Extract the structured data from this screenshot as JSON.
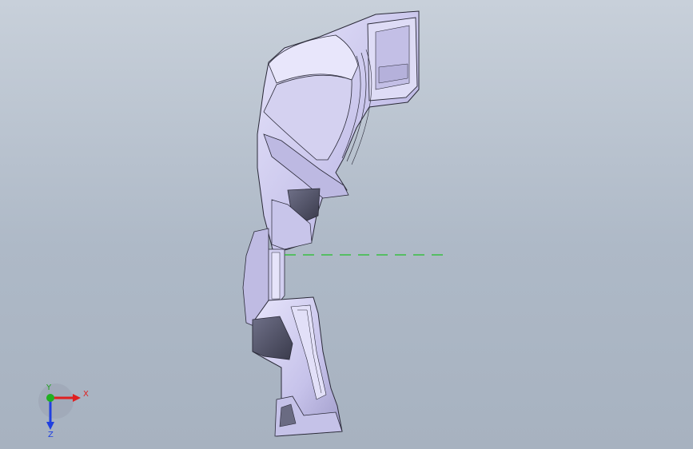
{
  "viewport": {
    "background_top": "#c8d0da",
    "background_bottom": "#a7b2c0"
  },
  "model": {
    "icon": "3d-part-side-view",
    "face_color": "#cbc8ec",
    "edge_color": "#2a2a38",
    "shadow_color": "#6c6f86"
  },
  "reference_line": {
    "color": "#22c02a",
    "style": "dashed"
  },
  "triad": {
    "x_label": "X",
    "y_label": "Y",
    "z_label": "Z",
    "x_color": "#e02020",
    "y_color": "#20b020",
    "z_color": "#2040e0"
  }
}
